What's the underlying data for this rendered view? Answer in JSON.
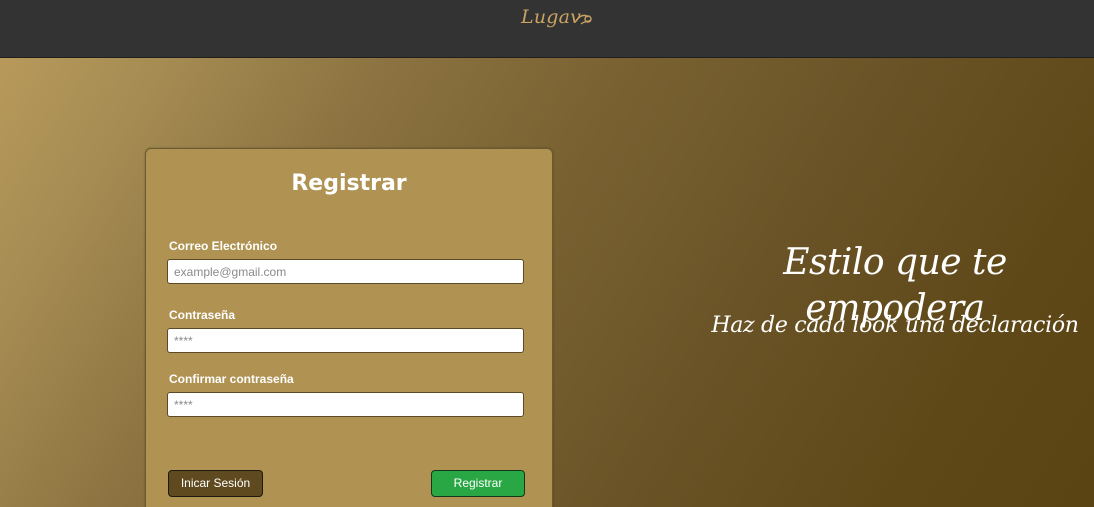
{
  "header": {
    "logo_text": "Lugav"
  },
  "register_form": {
    "title": "Registrar",
    "email": {
      "label": "Correo Electrónico",
      "placeholder": "example@gmail.com",
      "value": ""
    },
    "password": {
      "label": "Contraseña",
      "placeholder": "****",
      "value": ""
    },
    "confirm_password": {
      "label": "Confirmar contraseña",
      "placeholder": "****",
      "value": ""
    },
    "login_button_label": "Inicar Sesión",
    "register_button_label": "Registrar"
  },
  "hero": {
    "headline": "Estilo que te empodera",
    "subheadline": "Haz de cada look una declaración"
  },
  "colors": {
    "topbar": "#333333",
    "logo": "#c7a262",
    "card": "#b09352",
    "login_button": "#5e4a1e",
    "register_button": "#29a745"
  },
  "icons": {
    "logo_mark": "scissors-flourish-icon"
  }
}
